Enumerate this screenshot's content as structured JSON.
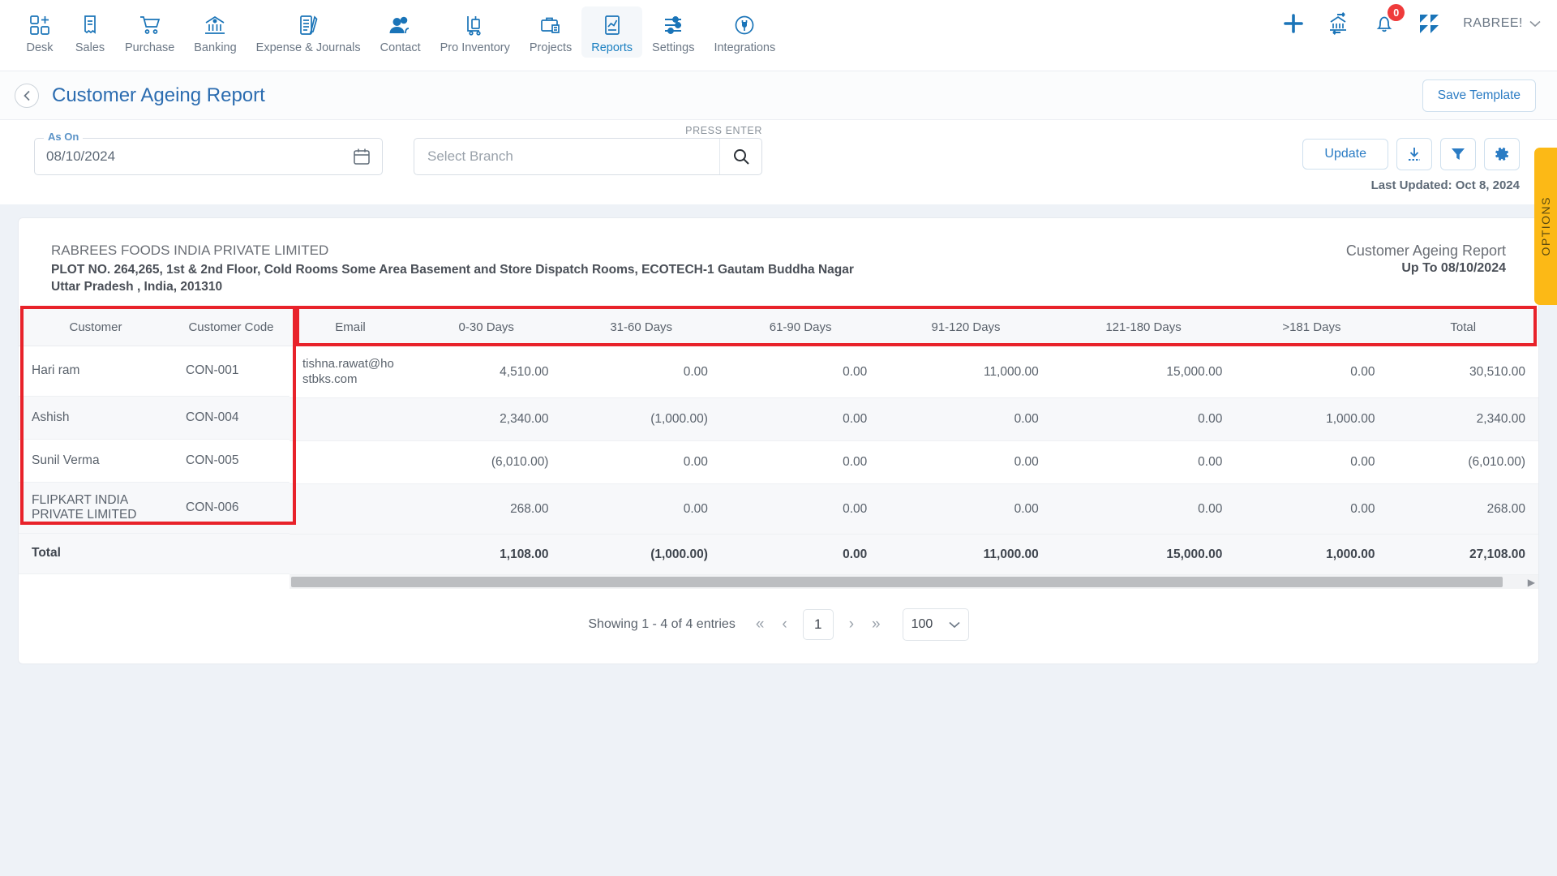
{
  "nav": {
    "items": [
      {
        "label": "Desk",
        "icon": "desk-icon",
        "active": false
      },
      {
        "label": "Sales",
        "icon": "sales-receipt-icon",
        "active": false
      },
      {
        "label": "Purchase",
        "icon": "purchase-cart-icon",
        "active": false
      },
      {
        "label": "Banking",
        "icon": "bank-icon",
        "active": false
      },
      {
        "label": "Expense & Journals",
        "icon": "journal-icon",
        "active": false
      },
      {
        "label": "Contact",
        "icon": "contact-people-icon",
        "active": false
      },
      {
        "label": "Pro Inventory",
        "icon": "inventory-trolley-icon",
        "active": false
      },
      {
        "label": "Projects",
        "icon": "projects-briefcase-icon",
        "active": false
      },
      {
        "label": "Reports",
        "icon": "reports-chart-icon",
        "active": true
      },
      {
        "label": "Settings",
        "icon": "settings-sliders-icon",
        "active": false
      },
      {
        "label": "Integrations",
        "icon": "integrations-plug-icon",
        "active": false
      }
    ],
    "right": {
      "add_icon": "plus-icon",
      "bank_transfer_icon": "bank-transfer-icon",
      "notification_icon": "bell-icon",
      "notification_count": "0",
      "apps_icon": "grid-apps-icon",
      "user_name": "RABREE!",
      "user_caret": "chevron-down-icon"
    }
  },
  "titlebar": {
    "back_icon": "back-chevron-icon",
    "title": "Customer Ageing Report",
    "save_template_label": "Save Template"
  },
  "filters": {
    "as_on_label": "As On",
    "as_on_value": "08/10/2024",
    "calendar_icon": "calendar-icon",
    "press_enter_hint": "PRESS ENTER",
    "branch_placeholder": "Select Branch",
    "branch_value": "",
    "search_icon": "search-icon",
    "update_label": "Update",
    "download_icon": "download-icon",
    "filter_icon": "funnel-filter-icon",
    "settings_icon": "gear-icon",
    "last_updated": "Last Updated: Oct 8, 2024"
  },
  "options_tab": {
    "label": "OPTIONS"
  },
  "report_header": {
    "org_name": "RABREES FOODS INDIA PRIVATE LIMITED",
    "address_line1": "PLOT NO. 264,265, 1st & 2nd Floor, Cold Rooms Some Area Basement and Store Dispatch Rooms, ECOTECH-1 Gautam Buddha Nagar",
    "address_line2": "Uttar Pradesh , India, 201310",
    "report_title": "Customer Ageing Report",
    "report_subtitle": "Up To 08/10/2024"
  },
  "table": {
    "frozen_columns": [
      "Customer",
      "Customer Code"
    ],
    "scroll_columns": [
      "Email",
      "0-30 Days",
      "31-60 Days",
      "61-90 Days",
      "91-120 Days",
      "121-180 Days",
      ">181 Days",
      "Total"
    ],
    "rows": [
      {
        "customer": "Hari ram",
        "code": "CON-001",
        "email": "tishna.rawat@hostbks.com",
        "d0_30": "4,510.00",
        "d31_60": "0.00",
        "d61_90": "0.00",
        "d91_120": "11,000.00",
        "d121_180": "15,000.00",
        "d181plus": "0.00",
        "total": "30,510.00"
      },
      {
        "customer": "Ashish",
        "code": "CON-004",
        "email": "",
        "d0_30": "2,340.00",
        "d31_60": "(1,000.00)",
        "d61_90": "0.00",
        "d91_120": "0.00",
        "d121_180": "0.00",
        "d181plus": "1,000.00",
        "total": "2,340.00"
      },
      {
        "customer": "Sunil Verma",
        "code": "CON-005",
        "email": "",
        "d0_30": "(6,010.00)",
        "d31_60": "0.00",
        "d61_90": "0.00",
        "d91_120": "0.00",
        "d121_180": "0.00",
        "d181plus": "0.00",
        "total": "(6,010.00)"
      },
      {
        "customer": "FLIPKART INDIA PRIVATE LIMITED",
        "code": "CON-006",
        "email": "",
        "d0_30": "268.00",
        "d31_60": "0.00",
        "d61_90": "0.00",
        "d91_120": "0.00",
        "d121_180": "0.00",
        "d181plus": "0.00",
        "total": "268.00"
      }
    ],
    "total_row": {
      "label": "Total",
      "code": "",
      "email": "",
      "d0_30": "1,108.00",
      "d31_60": "(1,000.00)",
      "d61_90": "0.00",
      "d91_120": "11,000.00",
      "d121_180": "15,000.00",
      "d181plus": "1,000.00",
      "total": "27,108.00"
    }
  },
  "pagination": {
    "showing": "Showing 1 - 4 of 4 entries",
    "first_icon": "first-page-icon",
    "prev_icon": "prev-page-icon",
    "current_page": "1",
    "next_icon": "next-page-icon",
    "last_icon": "last-page-icon",
    "page_size": "100",
    "page_size_caret": "chevron-down-icon"
  },
  "colors": {
    "accent_blue": "#2b7cc4",
    "nav_icon_blue": "#1a74b8",
    "badge_red": "#ef3b3b",
    "options_yellow": "#fcb916",
    "annotation_red": "#e8222a"
  }
}
